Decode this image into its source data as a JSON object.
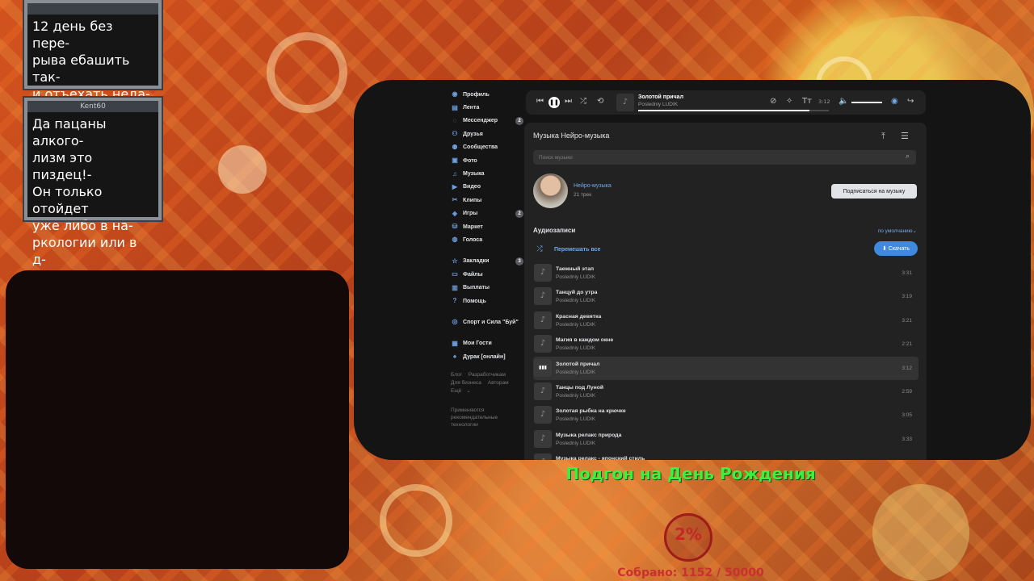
{
  "chat": [
    {
      "header": "",
      "text": "12 день без пере-\nрыва ебашить так-\nи отъехать неда-\nлеко"
    },
    {
      "header": "Kent60",
      "text": "Да пацаны алкого-\nлизм это пиздец!-\nОн только отойдет\nуже либо в на-\nркологии или в д-\nурке!"
    }
  ],
  "sidebar": {
    "items": [
      {
        "label": "Профиль",
        "icon": "user-icon",
        "badge": ""
      },
      {
        "label": "Лента",
        "icon": "news-icon",
        "badge": ""
      },
      {
        "label": "Мессенджер",
        "icon": "message-icon",
        "badge": "2"
      },
      {
        "label": "Друзья",
        "icon": "friends-icon",
        "badge": ""
      },
      {
        "label": "Сообщества",
        "icon": "groups-icon",
        "badge": ""
      },
      {
        "label": "Фото",
        "icon": "photo-icon",
        "badge": ""
      },
      {
        "label": "Музыка",
        "icon": "music-icon",
        "badge": ""
      },
      {
        "label": "Видео",
        "icon": "video-icon",
        "badge": ""
      },
      {
        "label": "Клипы",
        "icon": "clips-icon",
        "badge": ""
      },
      {
        "label": "Игры",
        "icon": "games-icon",
        "badge": "2"
      },
      {
        "label": "Маркет",
        "icon": "market-icon",
        "badge": ""
      },
      {
        "label": "Голоса",
        "icon": "votes-icon",
        "badge": ""
      }
    ],
    "items2": [
      {
        "label": "Закладки",
        "icon": "bookmark-icon",
        "badge": "3"
      },
      {
        "label": "Файлы",
        "icon": "files-icon",
        "badge": ""
      },
      {
        "label": "Выплаты",
        "icon": "payments-icon",
        "badge": ""
      },
      {
        "label": "Помощь",
        "icon": "help-icon",
        "badge": ""
      }
    ],
    "items3": [
      {
        "label": "Спорт и Сила \"Буй\"",
        "icon": "app-icon",
        "badge": ""
      }
    ],
    "items4": [
      {
        "label": "Мои Гости",
        "icon": "guests-icon",
        "badge": ""
      },
      {
        "label": "Дурак [онлайн]",
        "icon": "cards-icon",
        "badge": ""
      }
    ],
    "footer_links": [
      "Блог",
      "Разработчикам",
      "Для бизнеса",
      "Авторам",
      "Ещё"
    ],
    "footer_note": "Применяются рекомендательные технологии"
  },
  "player": {
    "title": "Золотой причал",
    "artist": "Posledniy LUDIK",
    "time": "3:12",
    "progress": 0.9
  },
  "music": {
    "title": "Музыка Нейро-музыка",
    "search_placeholder": "Поиск музыки",
    "playlist_name": "Нейро-музыка",
    "playlist_count": "21 трек",
    "subscribe_label": "Подписаться на музыку",
    "audio_header": "Аудиозаписи",
    "sort_label": "по умолчанию",
    "shuffle_label": "Перемешать все",
    "download_label": "Скачать",
    "tracks": [
      {
        "title": "Таежный этап",
        "artist": "Posledniy LUDIK",
        "duration": "3:31",
        "active": false
      },
      {
        "title": "Танцуй до утра",
        "artist": "Posledniy LUDIK",
        "duration": "3:19",
        "active": false
      },
      {
        "title": "Красная девятка",
        "artist": "Posledniy LUDIK",
        "duration": "3:21",
        "active": false
      },
      {
        "title": "Магия в каждом окне",
        "artist": "Posledniy LUDIK",
        "duration": "2:21",
        "active": false
      },
      {
        "title": "Золотой причал",
        "artist": "Posledniy LUDIK",
        "duration": "3:12",
        "active": true
      },
      {
        "title": "Танцы под Луной",
        "artist": "Posledniy LUDIK",
        "duration": "2:59",
        "active": false
      },
      {
        "title": "Золотая рыбка на крючке",
        "artist": "Posledniy LUDIK",
        "duration": "3:05",
        "active": false
      },
      {
        "title": "Музыка релакс природа",
        "artist": "Posledniy LUDIK",
        "duration": "3:33",
        "active": false
      },
      {
        "title": "Музыка релакс - японский стиль",
        "artist": "",
        "duration": "",
        "active": false
      }
    ]
  },
  "goal": {
    "title": "Подгон на День Рождения",
    "percent": "2%",
    "collected": "Собрано: 1152 / 50000"
  }
}
